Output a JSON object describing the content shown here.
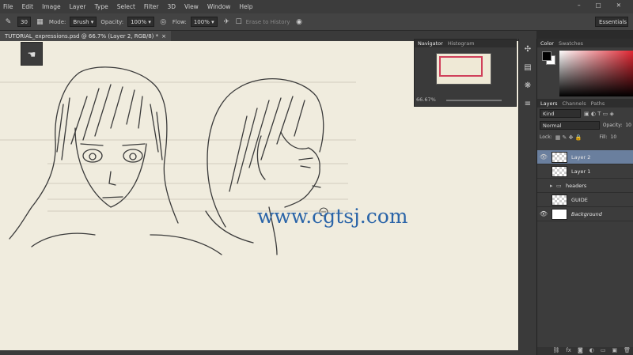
{
  "menu": [
    "File",
    "Edit",
    "Image",
    "Layer",
    "Type",
    "Select",
    "Filter",
    "3D",
    "View",
    "Window",
    "Help"
  ],
  "options": {
    "brush_size": "30",
    "mode_label": "Mode:",
    "mode_value": "Brush",
    "opacity_label": "Opacity:",
    "opacity_value": "100%",
    "flow_label": "Flow:",
    "flow_value": "100%",
    "erase_label": "Erase to History",
    "workspace": "Essentials"
  },
  "document": {
    "tab_title": "TUTORIAL_expressions.psd @ 66.7% (Layer 2, RGB/8) *",
    "close_glyph": "×"
  },
  "navigator": {
    "tabs": [
      "Navigator",
      "Histogram"
    ],
    "zoom": "66.67%"
  },
  "color_panel": {
    "tabs": [
      "Color",
      "Swatches"
    ],
    "fg_color": "#000000",
    "bg_color": "#ffffff"
  },
  "layers_panel": {
    "tabs": [
      "Layers",
      "Channels",
      "Paths"
    ],
    "kind": "Kind",
    "blend": "Normal",
    "opacity_label": "Opacity:",
    "opacity_value": "10",
    "lock_label": "Lock:",
    "fill_label": "Fill:",
    "fill_value": "10",
    "layers": [
      {
        "name": "Layer 2",
        "visible": true,
        "active": true
      },
      {
        "name": "Layer 1",
        "visible": false,
        "active": false
      },
      {
        "name": "headers",
        "visible": false,
        "active": false
      },
      {
        "name": "GUIDE",
        "visible": false,
        "active": false
      },
      {
        "name": "Background",
        "visible": true,
        "active": false
      }
    ]
  },
  "watermark": "www.cgtsj.com"
}
